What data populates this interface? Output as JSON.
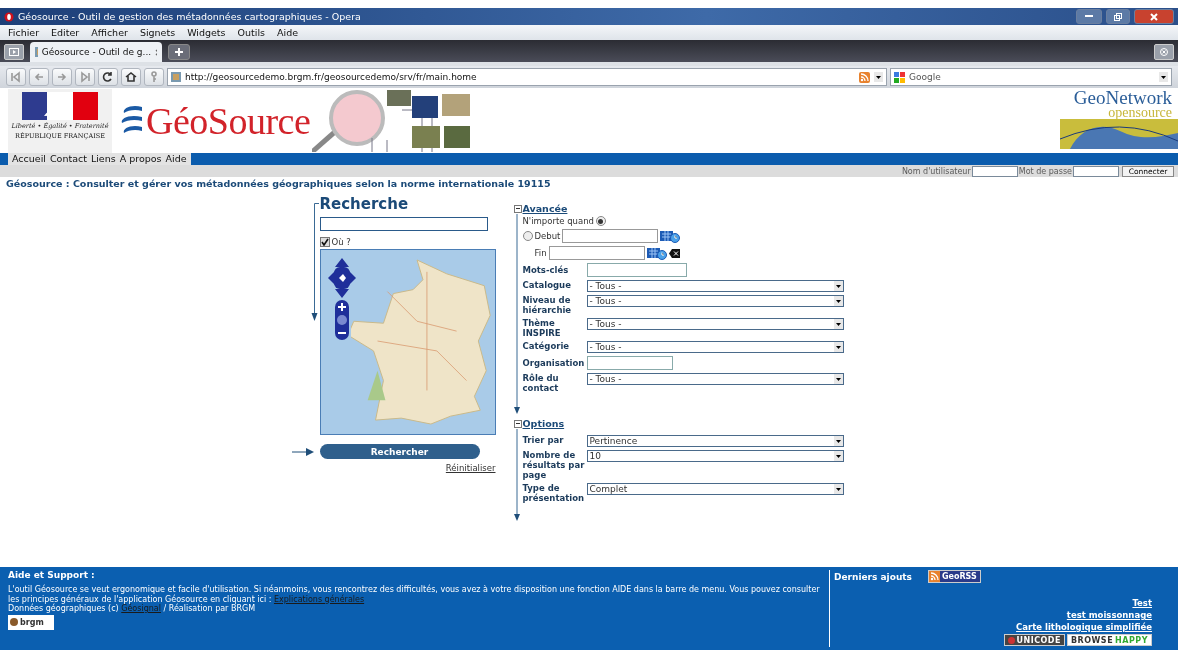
{
  "window": {
    "title": "Géosource - Outil de gestion des métadonnées cartographiques - Opera"
  },
  "menu_bar": [
    "Fichier",
    "Editer",
    "Afficher",
    "Signets",
    "Widgets",
    "Outils",
    "Aide"
  ],
  "tabs": [
    {
      "label": "Géosource - Outil de g...",
      "selected": true
    }
  ],
  "address_bar": {
    "url": "http://geosourcedemo.brgm.fr/geosourcedemo/srv/fr/main.home",
    "search_engine": "Google"
  },
  "header": {
    "motto": "Liberté • Égalité • Fraternité",
    "republic": "RÉPUBLIQUE FRANÇAISE",
    "logo": "GéoSource",
    "partner": "GeoNetwork",
    "partner_sub": "opensource"
  },
  "nav": [
    "Accueil",
    "Contact",
    "Liens",
    "A propos",
    "Aide"
  ],
  "login": {
    "username_label": "Nom d'utilisateur",
    "password_label": "Mot de passe",
    "button": "Connecter"
  },
  "subtitle": "Géosource : Consulter et gérer vos métadonnées géographiques selon la norme internationale 19115",
  "search": {
    "title": "Recherche",
    "where": {
      "label": "Où ?",
      "checked": true
    },
    "submit": "Rechercher",
    "reset": "Réinitialiser"
  },
  "advanced": {
    "title": "Avancée",
    "expanded": true,
    "dates": [
      {
        "label": "N'importe quand",
        "selected": true
      },
      {
        "label": "Debut",
        "selected": false
      }
    ],
    "end_label": "Fin",
    "fields": [
      {
        "kind": "text",
        "label": "Mots-clés"
      },
      {
        "kind": "select",
        "label": "Catalogue",
        "value": "- Tous -"
      },
      {
        "kind": "select",
        "label": "Niveau de hiérarchie",
        "value": "- Tous -"
      },
      {
        "kind": "select",
        "label": "Thème INSPIRE",
        "value": "- Tous -"
      },
      {
        "kind": "select",
        "label": "Catégorie",
        "value": "- Tous -"
      },
      {
        "kind": "text",
        "label": "Organisation"
      },
      {
        "kind": "select",
        "label": "Rôle du contact",
        "value": "- Tous -"
      }
    ]
  },
  "options": {
    "title": "Options",
    "expanded": true,
    "fields": [
      {
        "kind": "select",
        "label": "Trier par",
        "value": "Pertinence"
      },
      {
        "kind": "select",
        "label": "Nombre de résultats par page",
        "value": "10"
      },
      {
        "kind": "select",
        "label": "Type de présentation",
        "value": "Complet"
      }
    ]
  },
  "footer": {
    "help_title": "Aide et Support :",
    "help_text": "L'outil Géosource se veut ergonomique et facile d'utilisation. Si néanmoins, vous rencontrez des difficultés, vous avez à votre disposition une fonction AIDE dans la barre de menu. Vous pouvez consulter les principes généraux de l'application Géosource en cliquant ici : ",
    "help_link": "Explications générales",
    "credit_before": "Données géographiques (c) ",
    "credit_link": "Géosignal",
    "credit_after": " / Réalisation par BRGM",
    "brgm_logo": "brgm",
    "latest_title": "Derniers ajouts",
    "rss_badge": "GeoRSS",
    "latest": [
      "Test",
      "test moissonnage",
      "Carte lithologique simplifiée"
    ],
    "badges": [
      {
        "kind": "unicode",
        "label": "UNICODE"
      },
      {
        "kind": "browsehappy",
        "label": "BROWSE",
        "label_2": "HAPPY"
      }
    ]
  }
}
